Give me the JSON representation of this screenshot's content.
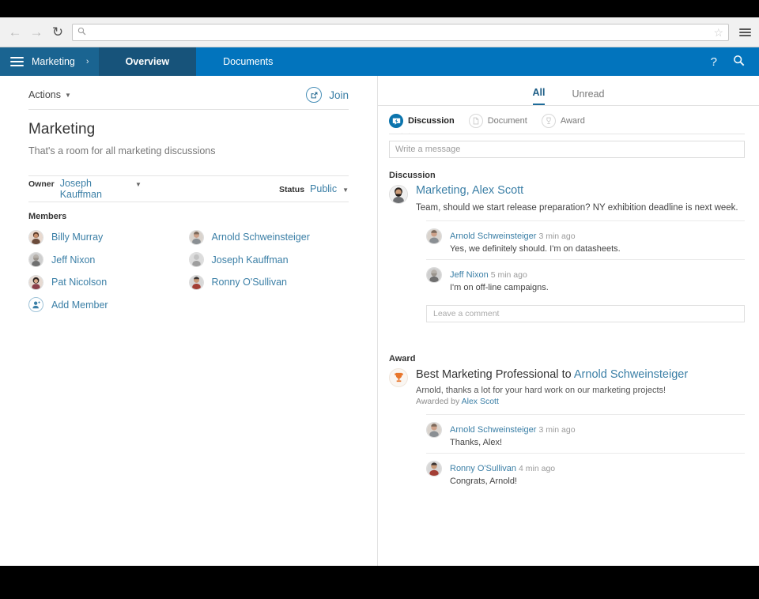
{
  "browser": {
    "back_icon": "arrow-left-icon",
    "forward_icon": "arrow-right-icon",
    "reload_icon": "reload-icon",
    "url_value": "",
    "url_placeholder": "",
    "search_icon": "search-icon",
    "bookmark_icon": "star-icon",
    "menu_icon": "hamburger-menu-icon"
  },
  "appnav": {
    "menu_icon": "hamburger-menu-icon",
    "brand": "Marketing",
    "brand_chevron": "›",
    "tabs": [
      {
        "label": "Overview",
        "active": true
      },
      {
        "label": "Documents",
        "active": false
      }
    ],
    "help_icon": "?",
    "search_icon": "search-icon",
    "colors": {
      "bar": "#0274bd",
      "brand_seg": "#1a6491",
      "active_seg": "#17537a"
    }
  },
  "left": {
    "actions_label": "Actions",
    "join_label": "Join",
    "join_icon": "join-external-link-icon",
    "title": "Marketing",
    "description": "That's a room for all marketing discussions",
    "owner_label": "Owner",
    "owner_value": "Joseph Kauffman",
    "status_label": "Status",
    "status_value": "Public",
    "members_label": "Members",
    "members": [
      {
        "name": "Billy Murray"
      },
      {
        "name": "Arnold Schweinsteiger"
      },
      {
        "name": "Jeff Nixon"
      },
      {
        "name": "Joseph Kauffman"
      },
      {
        "name": "Pat Nicolson"
      },
      {
        "name": "Ronny O'Sullivan"
      }
    ],
    "add_member_label": "Add Member",
    "add_member_icon": "add-user-icon"
  },
  "right": {
    "feed_tabs": [
      {
        "label": "All",
        "active": true
      },
      {
        "label": "Unread",
        "active": false
      }
    ],
    "composer_types": [
      {
        "label": "Discussion",
        "icon": "discussion-icon",
        "active": true
      },
      {
        "label": "Document",
        "icon": "document-icon",
        "active": false
      },
      {
        "label": "Award",
        "icon": "award-icon",
        "active": false
      }
    ],
    "message_placeholder": "Write a message",
    "discussion_section_label": "Discussion",
    "discussion_post": {
      "title_room": "Marketing,",
      "title_author": "Alex Scott",
      "body": "Team, should we start release preparation? NY exhibition deadline is next week.",
      "comments": [
        {
          "name": "Arnold Schweinsteiger",
          "time": "3 min ago",
          "text": "Yes, we definitely should.  I'm on datasheets."
        },
        {
          "name": "Jeff Nixon",
          "time": "5 min ago",
          "text": "I'm on off-line campaigns."
        }
      ],
      "comment_placeholder": "Leave a comment"
    },
    "award_section_label": "Award",
    "award_post": {
      "icon": "trophy-icon",
      "title": "Best Marketing Professional",
      "to_label": "to",
      "recipient": "Arnold Schweinsteiger",
      "body": "Arnold, thanks a lot for your hard work on our marketing projects!",
      "awarded_by_label": "Awarded by",
      "awarded_by": "Alex Scott",
      "comments": [
        {
          "name": "Arnold Schweinsteiger",
          "time": "3 min ago",
          "text": "Thanks, Alex!"
        },
        {
          "name": "Ronny O'Sullivan",
          "time": "4 min ago",
          "text": "Congrats, Arnold!"
        }
      ]
    }
  }
}
